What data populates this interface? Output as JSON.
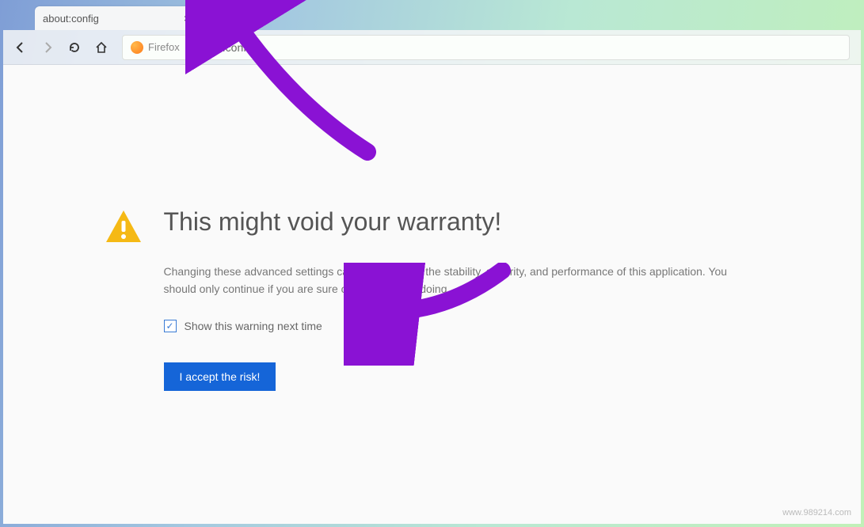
{
  "tab": {
    "title": "about:config",
    "close_glyph": "×"
  },
  "toolbar": {
    "new_tab_glyph": "+",
    "identity_label": "Firefox",
    "url": "about:config"
  },
  "warning": {
    "title": "This might void your warranty!",
    "description": "Changing these advanced settings can be harmful to the stability, security, and performance of this application. You should only continue if you are sure of what you are doing.",
    "checkbox_label": "Show this warning next time",
    "checkbox_checked_glyph": "✓",
    "accept_label": "I accept the risk!"
  },
  "watermark": "www.989214.com"
}
